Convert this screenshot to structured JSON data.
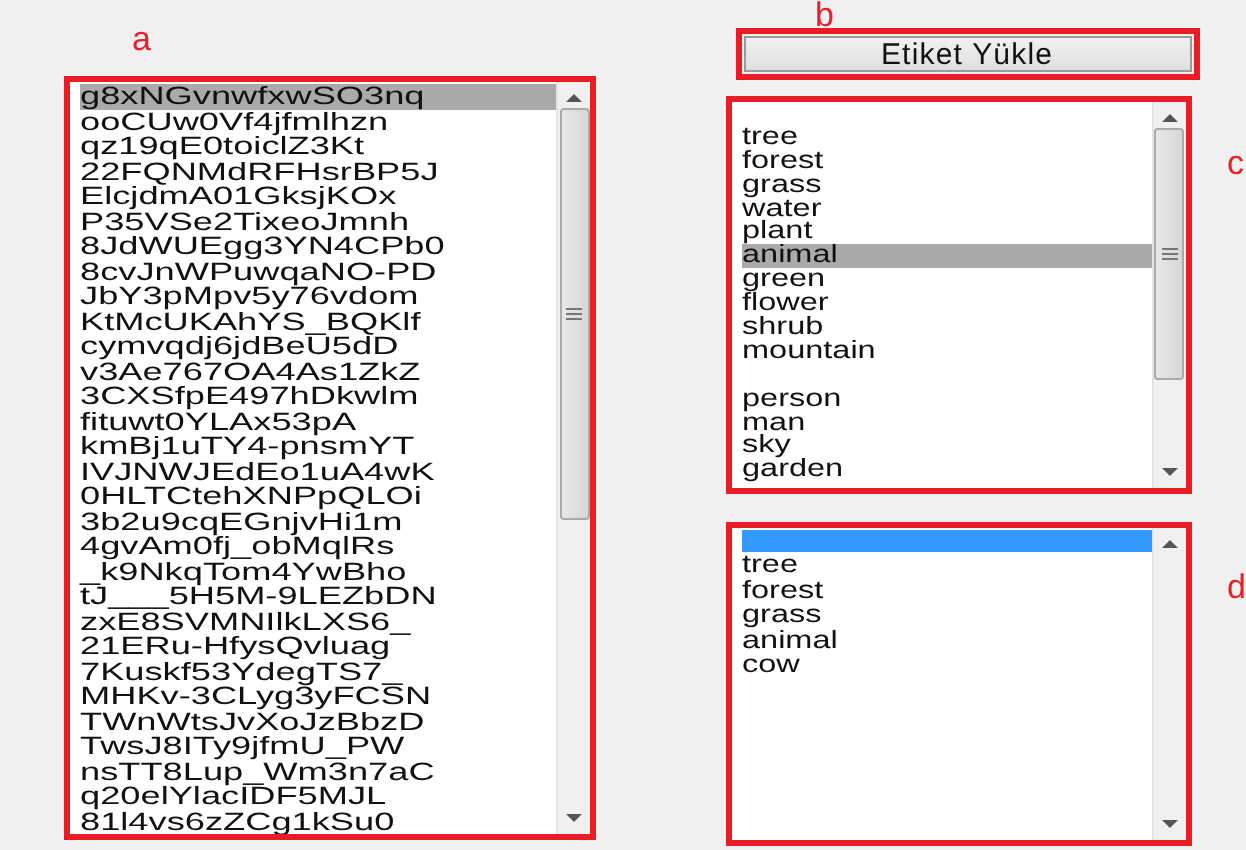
{
  "annotations": {
    "a": "a",
    "b": "b",
    "c": "c",
    "d": "d"
  },
  "image_list": {
    "items": [
      {
        "text": "g8xNGvnwfxwSO3nq",
        "selected": true
      },
      {
        "text": "ooCUw0Vf4jfmlhzn",
        "selected": false
      },
      {
        "text": "qz19qE0toiclZ3Kt",
        "selected": false
      },
      {
        "text": "22FQNMdRFHsrBP5J",
        "selected": false
      },
      {
        "text": "ElcjdmA01GksjKOx",
        "selected": false
      },
      {
        "text": "P35VSe2TixeoJmnh",
        "selected": false
      },
      {
        "text": "8JdWUEgg3YN4CPb0",
        "selected": false
      },
      {
        "text": "8cvJnWPuwqaNO-PD",
        "selected": false
      },
      {
        "text": "JbY3pMpv5y76vdom",
        "selected": false
      },
      {
        "text": "KtMcUKAhYS_BQKlf",
        "selected": false
      },
      {
        "text": "cymvqdj6jdBeU5dD",
        "selected": false
      },
      {
        "text": "v3Ae767OA4As1ZkZ",
        "selected": false
      },
      {
        "text": "3CXSfpE497hDkwlm",
        "selected": false
      },
      {
        "text": "fituwt0YLAx53pA",
        "selected": false
      },
      {
        "text": "kmBj1uTY4-pnsmYT",
        "selected": false
      },
      {
        "text": "IVJNWJEdEo1uA4wK",
        "selected": false
      },
      {
        "text": "0HLTCtehXNPpQLOi",
        "selected": false
      },
      {
        "text": "3b2u9cqEGnjvHi1m",
        "selected": false
      },
      {
        "text": "4gvAm0fj_obMqlRs",
        "selected": false
      },
      {
        "text": "_k9NkqTom4YwBho",
        "selected": false
      },
      {
        "text": "tJ___5H5M-9LEZbDN",
        "selected": false
      },
      {
        "text": "zxE8SVMNIlkLXS6_",
        "selected": false
      },
      {
        "text": "21ERu-HfysQvluag",
        "selected": false
      },
      {
        "text": "7Kuskf53YdegTS7_",
        "selected": false
      },
      {
        "text": "MHKv-3CLyg3yFCSN",
        "selected": false
      },
      {
        "text": "TWnWtsJvXoJzBbzD",
        "selected": false
      },
      {
        "text": "TwsJ8ITy9jfmU_PW",
        "selected": false
      },
      {
        "text": "nsTT8Lup_Wm3n7aC",
        "selected": false
      },
      {
        "text": "q20elYlacIDF5MJL",
        "selected": false
      },
      {
        "text": "81l4vs6zZCg1kSu0",
        "selected": false
      }
    ]
  },
  "load_button": {
    "label": "Etiket Yükle"
  },
  "tag_list": {
    "items": [
      {
        "kind": "blank"
      },
      {
        "kind": "text",
        "text": "tree",
        "selected": false
      },
      {
        "kind": "text",
        "text": "forest",
        "selected": false
      },
      {
        "kind": "text",
        "text": "grass",
        "selected": false
      },
      {
        "kind": "text",
        "text": "water",
        "selected": false
      },
      {
        "kind": "text",
        "text": "plant",
        "selected": false
      },
      {
        "kind": "text",
        "text": "animal",
        "selected": true
      },
      {
        "kind": "text",
        "text": "green",
        "selected": false
      },
      {
        "kind": "text",
        "text": "flower",
        "selected": false
      },
      {
        "kind": "text",
        "text": "shrub",
        "selected": false
      },
      {
        "kind": "text",
        "text": "mountain",
        "selected": false
      },
      {
        "kind": "blank"
      },
      {
        "kind": "text",
        "text": "person",
        "selected": false
      },
      {
        "kind": "text",
        "text": "man",
        "selected": false
      },
      {
        "kind": "text",
        "text": "sky",
        "selected": false
      },
      {
        "kind": "text",
        "text": "garden",
        "selected": false
      }
    ]
  },
  "result_list": {
    "blank_row_selected": true,
    "items": [
      {
        "text": "tree",
        "selected": false
      },
      {
        "text": "forest",
        "selected": false
      },
      {
        "text": "grass",
        "selected": false
      },
      {
        "text": "animal",
        "selected": false
      },
      {
        "text": "cow",
        "selected": false
      }
    ]
  }
}
